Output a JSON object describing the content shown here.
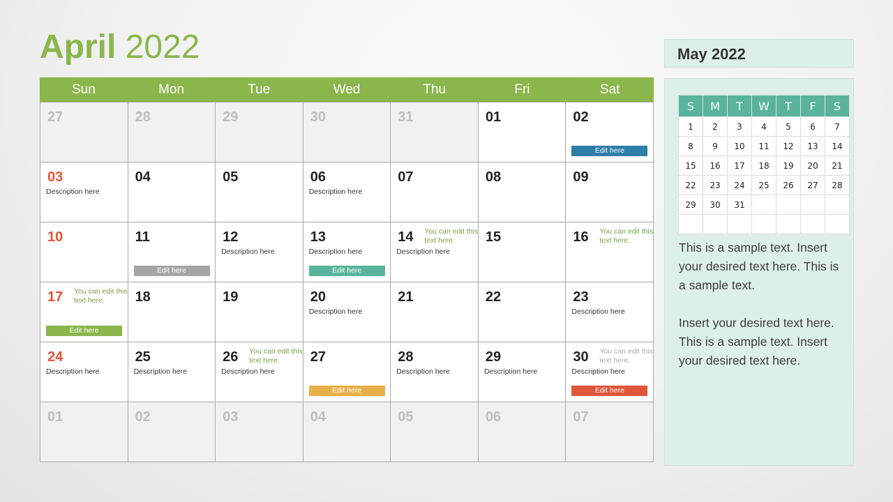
{
  "title": {
    "month": "April",
    "year": "2022"
  },
  "colors": {
    "accent": "#8ab64c",
    "sunday": "#e0573a",
    "blue": "#2e7ea8",
    "grey": "#a5a5a5",
    "teal": "#5ab49c",
    "green": "#8ab64c",
    "yellow": "#e9b04a",
    "orange": "#e0573a"
  },
  "weekdays": [
    "Sun",
    "Mon",
    "Tue",
    "Wed",
    "Thu",
    "Fri",
    "Sat"
  ],
  "days": [
    {
      "n": "27",
      "other": true
    },
    {
      "n": "28",
      "other": true
    },
    {
      "n": "29",
      "other": true
    },
    {
      "n": "30",
      "other": true
    },
    {
      "n": "31",
      "other": true
    },
    {
      "n": "01"
    },
    {
      "n": "02",
      "edit": "Edit here",
      "edit_color": "#2e7ea8"
    },
    {
      "n": "03",
      "desc": "Description here"
    },
    {
      "n": "04"
    },
    {
      "n": "05"
    },
    {
      "n": "06",
      "desc": "Description here"
    },
    {
      "n": "07"
    },
    {
      "n": "08"
    },
    {
      "n": "09"
    },
    {
      "n": "10"
    },
    {
      "n": "11",
      "edit": "Edit here",
      "edit_color": "#a5a5a5"
    },
    {
      "n": "12",
      "desc": "Description here"
    },
    {
      "n": "13",
      "desc": "Description here",
      "edit": "Edit here",
      "edit_color": "#5ab49c"
    },
    {
      "n": "14",
      "desc": "Description here",
      "note": "You can edit this text here."
    },
    {
      "n": "15"
    },
    {
      "n": "16",
      "note": "You can edit this text here."
    },
    {
      "n": "17",
      "note": "You can edit this text here.",
      "edit": "Edit here",
      "edit_color": "#8ab64c"
    },
    {
      "n": "18"
    },
    {
      "n": "19"
    },
    {
      "n": "20",
      "desc": "Description here"
    },
    {
      "n": "21"
    },
    {
      "n": "22"
    },
    {
      "n": "23",
      "desc": "Description here"
    },
    {
      "n": "24",
      "desc": "Description here"
    },
    {
      "n": "25",
      "desc": "Description here"
    },
    {
      "n": "26",
      "desc": "Description here",
      "note": "You can edit this text here."
    },
    {
      "n": "27",
      "edit": "Edit here",
      "edit_color": "#e9b04a"
    },
    {
      "n": "28",
      "desc": "Description here"
    },
    {
      "n": "29",
      "desc": "Description here"
    },
    {
      "n": "30",
      "desc": "Description here",
      "note": "You can edit this text here.",
      "note_grey": true,
      "edit": "Edit here",
      "edit_color": "#e0573a"
    },
    {
      "n": "01",
      "other": true
    },
    {
      "n": "02",
      "other": true
    },
    {
      "n": "03",
      "other": true
    },
    {
      "n": "04",
      "other": true
    },
    {
      "n": "05",
      "other": true
    },
    {
      "n": "06",
      "other": true
    },
    {
      "n": "07",
      "other": true
    }
  ],
  "sidebar": {
    "title": "May 2022",
    "mini_headers": [
      "S",
      "M",
      "T",
      "W",
      "T",
      "F",
      "S"
    ],
    "mini_rows": [
      [
        "1",
        "2",
        "3",
        "4",
        "5",
        "6",
        "7"
      ],
      [
        "8",
        "9",
        "10",
        "11",
        "12",
        "13",
        "14"
      ],
      [
        "15",
        "16",
        "17",
        "18",
        "19",
        "20",
        "21"
      ],
      [
        "22",
        "23",
        "24",
        "25",
        "26",
        "27",
        "28"
      ],
      [
        "29",
        "30",
        "31",
        "",
        "",
        "",
        ""
      ],
      [
        "",
        "",
        "",
        "",
        "",
        "",
        ""
      ]
    ],
    "text1": "This is a sample text. Insert your desired text here. This is a sample text.",
    "text2": "Insert your desired text here. This is a sample text. Insert your desired text here."
  }
}
